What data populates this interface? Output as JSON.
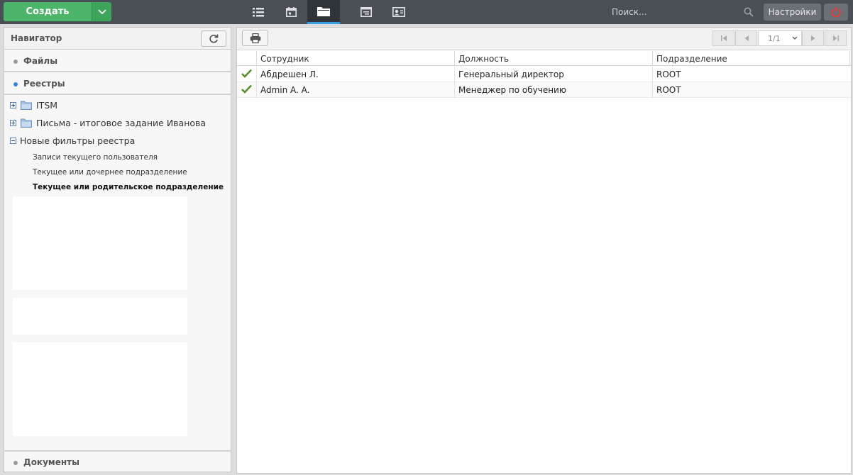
{
  "topbar": {
    "create_label": "Создать",
    "search_placeholder": "Поиск...",
    "settings_label": "Настройки",
    "nav_icons": [
      "list-icon",
      "calendar-icon",
      "folder-icon",
      "registry-icon",
      "contact-card-icon"
    ],
    "active_icon": "folder-icon"
  },
  "navigator": {
    "title": "Навигатор",
    "sections": {
      "files": "Файлы",
      "registers": "Реестры",
      "documents": "Документы"
    },
    "tree": [
      {
        "label": "ITSM",
        "expanded": false
      },
      {
        "label": "Письма - итоговое задание Иванова",
        "expanded": false
      },
      {
        "label": "Новые фильтры реестра",
        "expanded": true
      }
    ],
    "filters": [
      "Записи текущего пользователя",
      "Текущее или дочернее подразделение",
      "Текущее или родительское подразделение"
    ],
    "selected_filter": "Текущее или родительское подразделение"
  },
  "pager": {
    "page": "1/1"
  },
  "grid": {
    "columns": [
      "Сотрудник",
      "Должность",
      "Подразделение"
    ],
    "rows": [
      {
        "employee": "Абдрешен Л.",
        "position": "Генеральный директор",
        "department": "ROOT"
      },
      {
        "employee": "Admin A. A.",
        "position": "Менеджер по обучению",
        "department": "ROOT"
      }
    ]
  },
  "colors": {
    "accent_green": "#4cb56a",
    "topbar": "#4a4f55",
    "active_tab": "#3aa0e6",
    "power_red": "#e53935"
  }
}
